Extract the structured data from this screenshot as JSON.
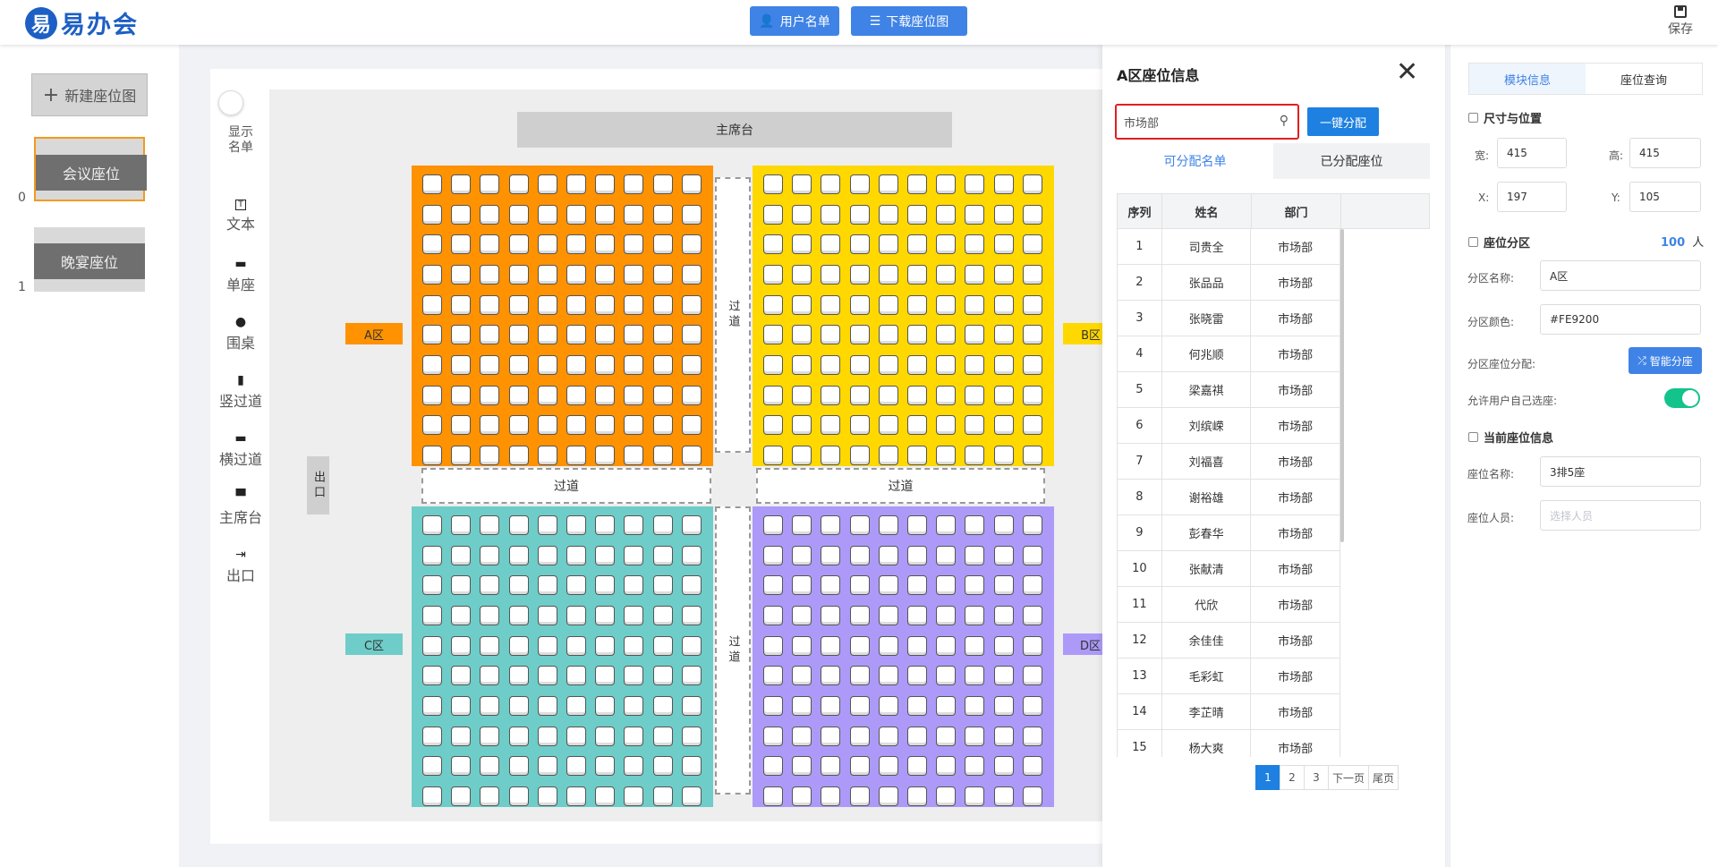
{
  "header": {
    "logo_mark": "易",
    "logo_text": "易办会",
    "user_list_label": "用户名单",
    "download_label": "下载座位图",
    "save_label": "保存"
  },
  "left": {
    "new_btn_label": "新建座位图",
    "thumbs": [
      {
        "index": "0",
        "label": "会议座位"
      },
      {
        "index": "1",
        "label": "晚宴座位"
      }
    ]
  },
  "toolbar": {
    "show_names": "显示\n名单",
    "items": [
      {
        "icon": "text-icon",
        "glyph": "T",
        "label": "文本"
      },
      {
        "icon": "seat-icon",
        "glyph": "▬",
        "label": "单座"
      },
      {
        "icon": "round-table-icon",
        "glyph": "●",
        "label": "围桌"
      },
      {
        "icon": "vertical-aisle-icon",
        "glyph": "▮",
        "label": "竖过道"
      },
      {
        "icon": "horizontal-aisle-icon",
        "glyph": "▬",
        "label": "横过道"
      },
      {
        "icon": "stage-icon",
        "glyph": "▀",
        "label": "主席台"
      },
      {
        "icon": "exit-icon",
        "glyph": "⇥",
        "label": "出口"
      }
    ]
  },
  "stage": {
    "main_stage": "主席台",
    "aisle": "过道",
    "aisle_vertical": "过道",
    "exit": "出口",
    "zones": [
      {
        "label": "A区",
        "color": "#FE9200"
      },
      {
        "label": "B区",
        "color": "#FFD800"
      },
      {
        "label": "C区",
        "color": "#6ECDC8"
      },
      {
        "label": "D区",
        "color": "#AD9AF8"
      }
    ]
  },
  "panel": {
    "title": "A区座位信息",
    "search_value": "市场部",
    "assign_label": "一键分配",
    "tab_available": "可分配名单",
    "tab_assigned": "已分配座位",
    "col_index": "序列",
    "col_name": "姓名",
    "col_dept": "部门",
    "rows": [
      {
        "i": "1",
        "name": "司贵全",
        "dept": "市场部"
      },
      {
        "i": "2",
        "name": "张品品",
        "dept": "市场部"
      },
      {
        "i": "3",
        "name": "张晓雷",
        "dept": "市场部"
      },
      {
        "i": "4",
        "name": "何兆顺",
        "dept": "市场部"
      },
      {
        "i": "5",
        "name": "梁嘉祺",
        "dept": "市场部"
      },
      {
        "i": "6",
        "name": "刘缤嵘",
        "dept": "市场部"
      },
      {
        "i": "7",
        "name": "刘福喜",
        "dept": "市场部"
      },
      {
        "i": "8",
        "name": "谢裕雄",
        "dept": "市场部"
      },
      {
        "i": "9",
        "name": "彭春华",
        "dept": "市场部"
      },
      {
        "i": "10",
        "name": "张献清",
        "dept": "市场部"
      },
      {
        "i": "11",
        "name": "代欣",
        "dept": "市场部"
      },
      {
        "i": "12",
        "name": "余佳佳",
        "dept": "市场部"
      },
      {
        "i": "13",
        "name": "毛彩虹",
        "dept": "市场部"
      },
      {
        "i": "14",
        "name": "李芷晴",
        "dept": "市场部"
      },
      {
        "i": "15",
        "name": "杨大爽",
        "dept": "市场部"
      }
    ],
    "pager": [
      "1",
      "2",
      "3",
      "下一页",
      "尾页"
    ]
  },
  "right": {
    "tab_module": "模块信息",
    "tab_query": "座位查询",
    "size_title": "尺寸与位置",
    "w_label": "宽:",
    "w_value": "415",
    "h_label": "高:",
    "h_value": "415",
    "x_label": "X:",
    "x_value": "197",
    "y_label": "Y:",
    "y_value": "105",
    "zone_title": "座位分区",
    "zone_count": "100",
    "zone_unit": "人",
    "zone_name_label": "分区名称:",
    "zone_name_value": "A区",
    "zone_color_label": "分区颜色:",
    "zone_color_value": "#FE9200",
    "zone_assign_label": "分区座位分配:",
    "smart_label": "智能分座",
    "allow_label": "允许用户自己选座:",
    "current_title": "当前座位信息",
    "seat_name_label": "座位名称:",
    "seat_name_value": "3排5座",
    "seat_person_label": "座位人员:",
    "seat_person_placeholder": "选择人员"
  }
}
